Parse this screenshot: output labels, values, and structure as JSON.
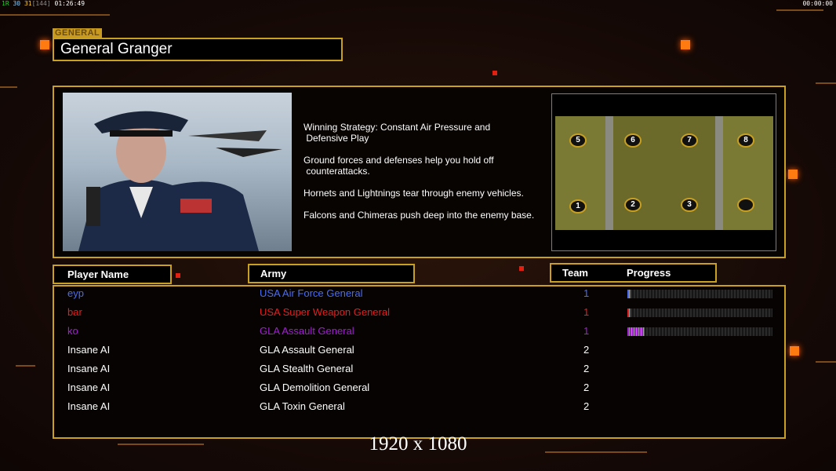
{
  "stats": {
    "a": "1R",
    "b": "30",
    "c": "31",
    "d": "[144]",
    "time": "01:26:49"
  },
  "clock": "00:00:00",
  "general": {
    "label": "GENERAL",
    "name": "General Granger"
  },
  "strategy": [
    "Winning Strategy: Constant Air Pressure and\n Defensive Play",
    "Ground forces and defenses help you hold off\n counterattacks.",
    "Hornets and Lightnings tear through enemy vehicles.",
    "Falcons and Chimeras push deep into the enemy base."
  ],
  "map": {
    "slots": [
      "5",
      "6",
      "7",
      "8",
      "1",
      "2",
      "3",
      ""
    ]
  },
  "headers": {
    "player": "Player Name",
    "army": "Army",
    "team": "Team",
    "progress": "Progress"
  },
  "players": [
    {
      "name": "eyp",
      "army": "USA Air Force General",
      "team": "1",
      "color": "#4a6cf0",
      "progress": 2
    },
    {
      "name": "bar",
      "army": "USA Super Weapon General",
      "team": "1",
      "color": "#e02020",
      "progress": 2
    },
    {
      "name": "ko",
      "army": "GLA Assault General",
      "team": "1",
      "color": "#a020d0",
      "progress": 12
    },
    {
      "name": "Insane AI",
      "army": "GLA Assault General",
      "team": "2",
      "color": "#ffffff"
    },
    {
      "name": "Insane AI",
      "army": "GLA Stealth General",
      "team": "2",
      "color": "#ffffff"
    },
    {
      "name": "Insane AI",
      "army": "GLA Demolition General",
      "team": "2",
      "color": "#ffffff"
    },
    {
      "name": "Insane AI",
      "army": "GLA Toxin General",
      "team": "2",
      "color": "#ffffff"
    }
  ],
  "resolution": "1920 x 1080"
}
